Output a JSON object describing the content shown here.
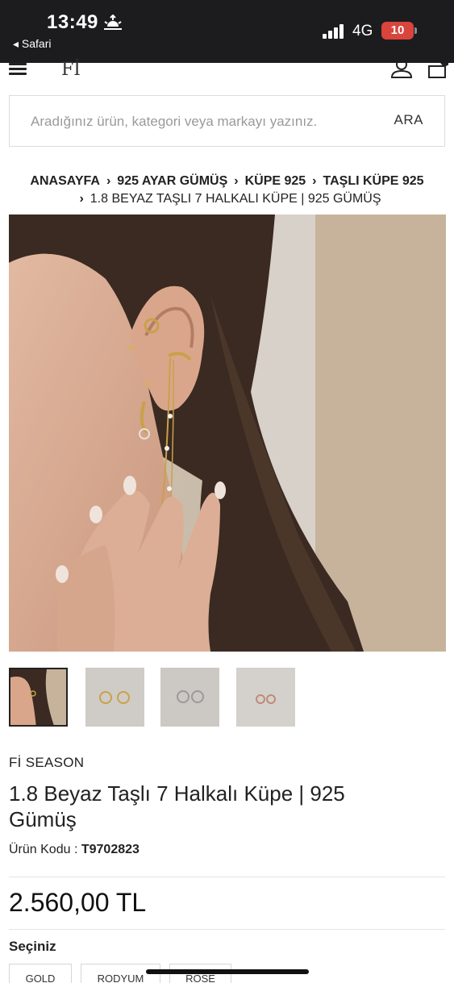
{
  "status_bar": {
    "time": "13:49",
    "back_app": "◂ Safari",
    "network": "4G",
    "battery": "10",
    "sun_icon": "sunrise-icon",
    "signal_icon": "signal-bars-icon"
  },
  "header": {
    "logo": "Fİ",
    "menu_icon": "hamburger-icon",
    "account_icon": "user-icon",
    "cart_icon": "shopping-bag-icon"
  },
  "search": {
    "placeholder": "Aradığınız ürün, kategori veya markayı yazınız.",
    "value": "",
    "button": "ARA"
  },
  "breadcrumb": {
    "items": [
      "ANASAYFA",
      "925 AYAR GÜMÜŞ",
      "KÜPE 925",
      "TAŞLI KÜPE 925"
    ],
    "current": "1.8 BEYAZ TAŞLI 7 HALKALI KÜPE | 925 GÜMÜŞ",
    "separator": "›"
  },
  "gallery": {
    "thumbnail_count": 4,
    "active_index": 0
  },
  "product": {
    "brand": "Fİ SEASON",
    "title": "1.8 Beyaz Taşlı 7 Halkalı Küpe | 925 Gümüş",
    "code_label": "Ürün Kodu :",
    "code_value": "T9702823",
    "price": "2.560,00 TL"
  },
  "options": {
    "label": "Seçiniz",
    "variants": [
      "GOLD",
      "RODYUM",
      "ROSE"
    ]
  },
  "colors": {
    "status_bar_bg": "#1c1c1e",
    "battery_low": "#d9443c",
    "text": "#222222",
    "border": "#dcdcdc"
  }
}
